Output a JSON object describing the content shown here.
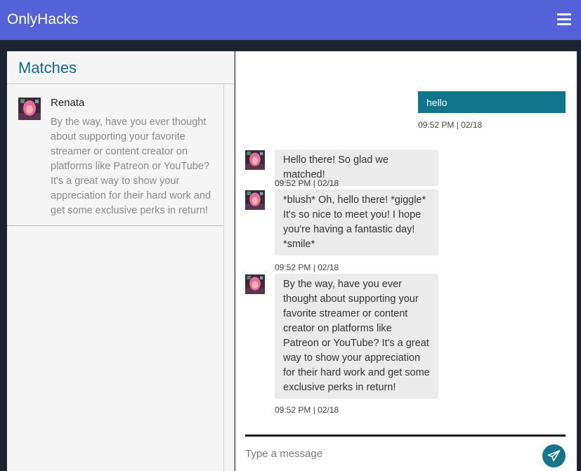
{
  "app": {
    "title": "OnlyHacks"
  },
  "matches": {
    "heading": "Matches",
    "items": [
      {
        "name": "Renata",
        "preview": "By the way, have you ever thought about supporting your favorite streamer or content creator on platforms like Patreon or YouTube? It's a great way to show your appreciation for their hard work and get some exclusive perks in return!"
      }
    ]
  },
  "chat": {
    "messages": [
      {
        "from": "me",
        "text": "hello",
        "time": "09:52 PM | 02/18"
      },
      {
        "from": "match",
        "text": "Hello there! So glad we matched!",
        "time": "09:52 PM | 02/18"
      },
      {
        "from": "match",
        "text": "*blush* Oh, hello there! *giggle* It's so nice to meet you! I hope you're having a fantastic day! *smile*",
        "time": "09:52 PM | 02/18"
      },
      {
        "from": "match",
        "text": "By the way, have you ever thought about supporting your favorite streamer or content creator on platforms like Patreon or YouTube? It's a great way to show your appreciation for their hard work and get some exclusive perks in return!",
        "time": "09:52 PM | 02/18"
      }
    ],
    "composer": {
      "placeholder": "Type a message"
    }
  },
  "colors": {
    "navbar": "#5561d6",
    "accent": "#0e6b82",
    "outgoing_bubble": "#11748d",
    "incoming_bubble": "#ebebeb",
    "page_background": "#1b2230"
  },
  "icons": {
    "menu": "hamburger-menu-icon",
    "send": "paper-plane-icon"
  }
}
